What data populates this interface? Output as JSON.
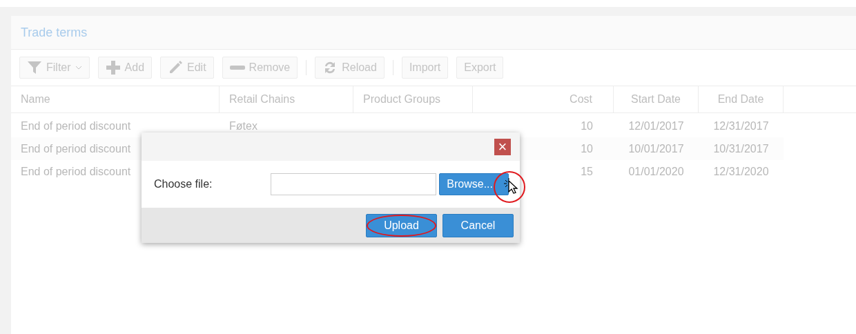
{
  "panel": {
    "title": "Trade terms"
  },
  "toolbar": [
    {
      "label": "Filter"
    },
    {
      "label": "Add"
    },
    {
      "label": "Edit"
    },
    {
      "label": "Remove"
    },
    {
      "label": "Reload"
    },
    {
      "label": "Import"
    },
    {
      "label": "Export"
    }
  ],
  "table": {
    "columns": [
      {
        "label": "Name"
      },
      {
        "label": "Retail Chains"
      },
      {
        "label": "Product Groups"
      },
      {
        "label": "Cost"
      },
      {
        "label": "Start Date"
      },
      {
        "label": "End Date"
      }
    ],
    "rows": [
      [
        "End of period discount",
        "Føtex",
        "",
        "10",
        "12/01/2017",
        "12/31/2017"
      ],
      [
        "End of period discount",
        "",
        "",
        "10",
        "10/01/2017",
        "10/31/2017"
      ],
      [
        "End of period discount",
        "",
        "",
        "15",
        "01/01/2020",
        "12/31/2020"
      ]
    ]
  },
  "dialog": {
    "close": "×",
    "label": "Choose file:",
    "browse": "Browse...",
    "buttons": [
      {
        "label": "Upload",
        "highlighted": true
      },
      {
        "label": "Cancel",
        "highlighted": false
      }
    ]
  }
}
